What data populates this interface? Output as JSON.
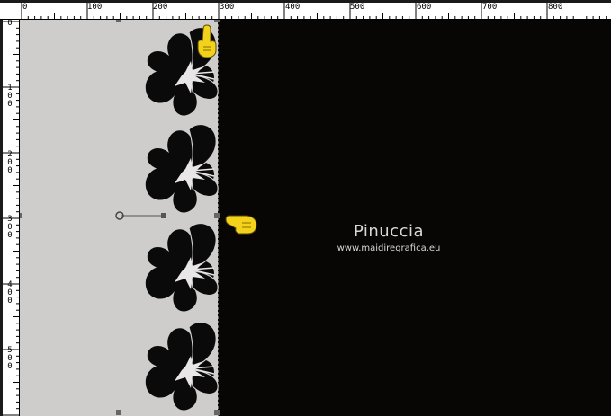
{
  "rulers": {
    "top_labels": [
      "0",
      "100",
      "200",
      "300",
      "400",
      "500",
      "600",
      "700",
      "800"
    ],
    "left_labels": [
      "0",
      "100",
      "200",
      "300",
      "400",
      "500"
    ]
  },
  "watermark": {
    "name": "Pinuccia",
    "url": "www.maidiregrafica.eu"
  },
  "colors": {
    "canvas_background": "#070605",
    "panel_gray": "#cfcccc",
    "pointer_yellow": "#f2d21b"
  },
  "icons": {
    "top_hand": "pointing-up-hand-icon",
    "side_hand": "pointing-left-hand-icon"
  }
}
